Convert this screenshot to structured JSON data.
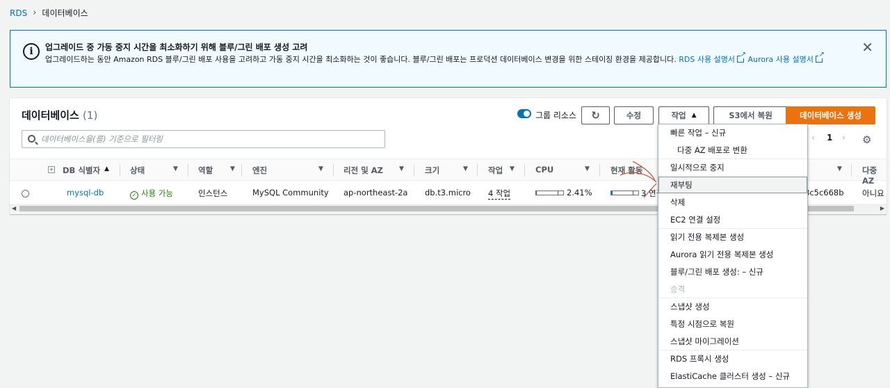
{
  "breadcrumb": {
    "root": "RDS",
    "current": "데이터베이스"
  },
  "banner": {
    "title": "업그레이드 중 가동 중지 시간을 최소화하기 위해 블루/그린 배포 생성 고려",
    "body": "업그레이드하는 동안 Amazon RDS 블루/그린 배포 사용을 고려하고 가동 중지 시간을 최소화하는 것이 좋습니다. 블루/그린 배포는 프로덕션 데이터베이스 변경을 위한 스테이징 환경을 제공합니다.",
    "link1": "RDS 사용 설명서",
    "link2": "Aurora 사용 설명서"
  },
  "panel": {
    "title": "데이터베이스",
    "count": "(1)",
    "group_toggle_label": "그룹 리소스",
    "modify_label": "수정",
    "actions_label": "작업",
    "restore_s3_label": "S3에서 복원",
    "create_label": "데이터베이스 생성",
    "search_placeholder": "데이터베이스을(를) 기준으로 필터링",
    "page": "1"
  },
  "table": {
    "headers": {
      "db_id": "DB 식별자",
      "status": "상태",
      "role": "역할",
      "engine": "엔진",
      "region": "리전 및 AZ",
      "size": "크기",
      "actions": "작업",
      "cpu": "CPU",
      "current": "현재 활동",
      "multi_az": "다중 AZ"
    },
    "rows": [
      {
        "db_id": "mysql-db",
        "status": "사용 가능",
        "role": "인스턴스",
        "engine": "MySQL Community",
        "region": "ap-northeast-2a",
        "size": "db.t3.micro",
        "actions": "4 작업",
        "cpu": "2.41%",
        "cpu_value": 2.41,
        "current": "3 연결",
        "vpc_tail": "8c5c668b",
        "multi_az": "아니요"
      }
    ]
  },
  "menu": {
    "items": [
      {
        "label": "빠른 작업 – 신규"
      },
      {
        "label": "다중 AZ 배포로 변환"
      },
      {
        "label": "일시적으로 중지"
      },
      {
        "label": "재부팅"
      },
      {
        "label": "삭제"
      },
      {
        "label": "EC2 연결 설정"
      },
      {
        "label": "읽기 전용 복제본 생성"
      },
      {
        "label": "Aurora 읽기 전용 복제본 생성"
      },
      {
        "label": "블루/그린 배포 생성: – 신규"
      },
      {
        "label": "승격"
      },
      {
        "label": "스냅샷 생성"
      },
      {
        "label": "특정 시점으로 복원"
      },
      {
        "label": "스냅샷 마이그레이션"
      },
      {
        "label": "RDS 프록시 생성"
      },
      {
        "label": "ElastiCache 클러스터 생성 – 신규"
      }
    ]
  },
  "colors": {
    "accent": "#0073bb",
    "primary": "#ec7211",
    "success": "#1d8102",
    "annotation": "#d13212"
  }
}
